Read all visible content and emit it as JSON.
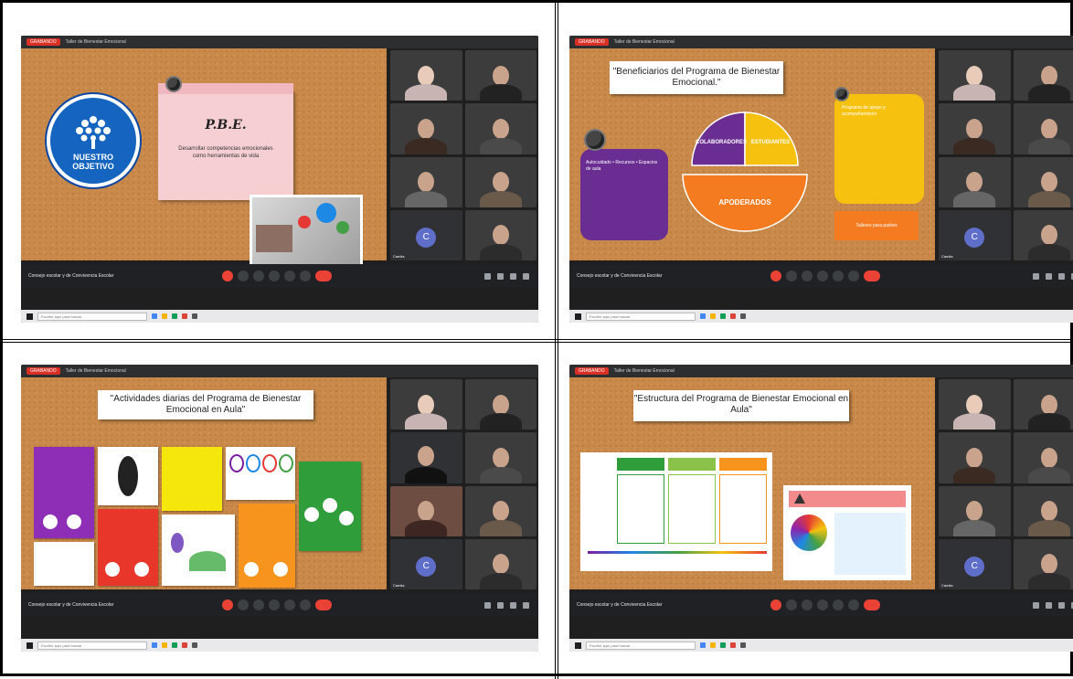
{
  "screenshots": [
    {
      "recording_label": "GRABANDO",
      "meeting_title": "Taller de Bienestar Emocional",
      "meeting_info": "Consejo escolar y de Convivencia Escolar",
      "taskbar_search": "Escribe aquí para buscar",
      "slide": {
        "badge_line1": "NUESTRO",
        "badge_line2": "OBJETIVO",
        "note_title": "P.B.E.",
        "note_body": "Desarrollar competencias emocionales como herramientas de vida"
      },
      "participant_name": "Camila"
    },
    {
      "recording_label": "GRABANDO",
      "meeting_title": "Taller de Bienestar Emocional",
      "meeting_info": "Consejo escolar y de Convivencia Escolar",
      "taskbar_search": "Escribe aquí para buscar",
      "slide": {
        "title": "\"Beneficiarios del Programa de Bienestar Emocional.\"",
        "segment_a": "COLABORADORES",
        "segment_b": "ESTUDIANTES",
        "segment_c": "APODERADOS",
        "purple_text": "Autocuidado • Recursos • Espacios de aula",
        "yellow_text": "Programa de apoyo y acompañamiento",
        "orange_text": "Talleres para padres"
      },
      "participant_name": "Camila"
    },
    {
      "recording_label": "GRABANDO",
      "meeting_title": "Taller de Bienestar Emocional",
      "meeting_info": "Consejo escolar y de Convivencia Escolar",
      "taskbar_search": "Escribe aquí para buscar",
      "slide": {
        "title": "\"Actividades diarias del Programa de Bienestar Emocional en Aula\""
      },
      "participant_name": "Camila"
    },
    {
      "recording_label": "GRABANDO",
      "meeting_title": "Taller de Bienestar Emocional",
      "meeting_info": "Consejo escolar y de Convivencia Escolar",
      "taskbar_search": "Escribe aquí para buscar",
      "slide": {
        "title": "\"Estructura del Programa de Bienestar Emocional en Aula\""
      },
      "participant_name": "Camila"
    }
  ]
}
